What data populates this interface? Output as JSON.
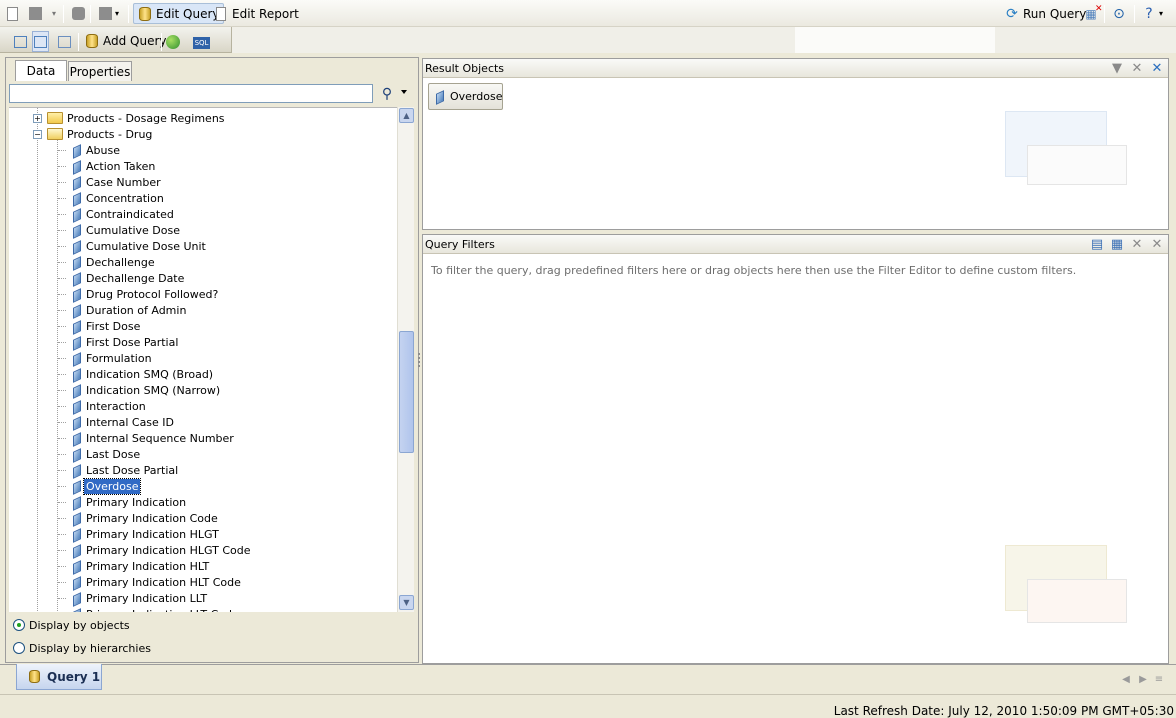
{
  "toolbar": {
    "edit_query": "Edit Query",
    "edit_report": "Edit Report",
    "run_query": "Run Query"
  },
  "toolbar2": {
    "add_query": "Add Query"
  },
  "left_panel": {
    "tabs": [
      "Data",
      "Properties"
    ],
    "search_value": "",
    "folders": [
      "Products - Dosage Regimens",
      "Products - Drug"
    ],
    "items": [
      "Abuse",
      "Action Taken",
      "Case Number",
      "Concentration",
      "Contraindicated",
      "Cumulative Dose",
      "Cumulative Dose Unit",
      "Dechallenge",
      "Dechallenge Date",
      "Drug Protocol Followed?",
      "Duration of Admin",
      "First Dose",
      "First Dose Partial",
      "Formulation",
      "Indication SMQ (Broad)",
      "Indication SMQ (Narrow)",
      "Interaction",
      "Internal Case ID",
      "Internal Sequence Number",
      "Last Dose",
      "Last Dose Partial",
      "Overdose",
      "Primary Indication",
      "Primary Indication Code",
      "Primary Indication HLGT",
      "Primary Indication HLGT Code",
      "Primary Indication HLT",
      "Primary Indication HLT Code",
      "Primary Indication LLT",
      "Primary Indication LLT Code"
    ],
    "selected_item": "Overdose",
    "display_by_objects": "Display by objects",
    "display_by_hierarchies": "Display by hierarchies"
  },
  "result_objects": {
    "title": "Result Objects",
    "objects": [
      "Overdose"
    ]
  },
  "query_filters": {
    "title": "Query Filters",
    "hint": "To filter the query, drag predefined filters here or drag objects here then use the Filter Editor to define custom filters."
  },
  "query_tab": "Query 1",
  "status": "Last Refresh Date: July 12, 2010 1:50:09 PM GMT+05:30"
}
